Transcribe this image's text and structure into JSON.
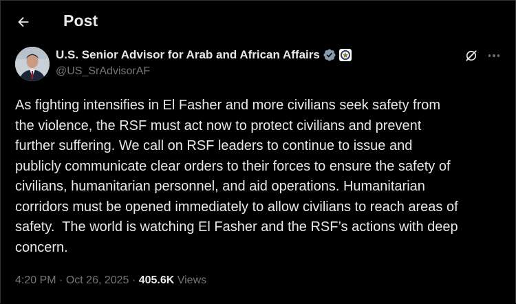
{
  "header": {
    "title": "Post"
  },
  "author": {
    "display_name": "U.S. Senior Advisor for Arab and African Affairs",
    "handle": "@US_SrAdvisorAF",
    "verified_badge": "verified-checkmark-icon",
    "affiliation_badge": "us-state-department-seal-icon"
  },
  "post": {
    "text": "As fighting intensifies in El Fasher and more civilians seek safety from\nthe violence, the RSF must act now to protect civilians and prevent\nfurther suffering. We call on RSF leaders to continue to issue and\npublicly communicate clear orders to their forces to ensure the safety of\ncivilians, humanitarian personnel, and aid operations. Humanitarian\ncorridors must be opened immediately to allow civilians to reach areas of\nsafety.  The world is watching El Fasher and the RSF’s actions with deep\nconcern.",
    "time": "4:20 PM",
    "separator": "·",
    "date": "Oct 26, 2025",
    "views_count": "405.6K",
    "views_label": "Views"
  },
  "icons": {
    "back": "arrow-left-icon",
    "grok": "grok-icon",
    "more": "more-horizontal-icon"
  },
  "colors": {
    "background": "#000000",
    "text_primary": "#e7e9ea",
    "text_secondary": "#71767b",
    "verified_badge": "#829aab",
    "border": "#2f3336"
  }
}
